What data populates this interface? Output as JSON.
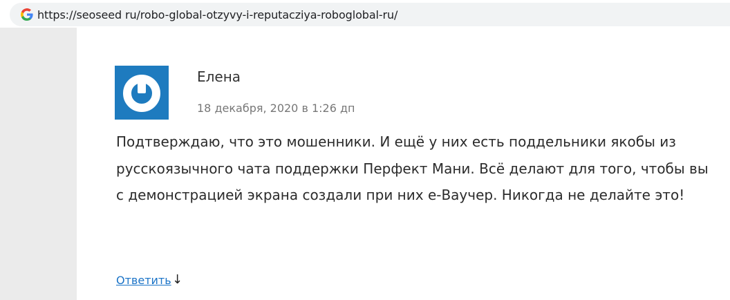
{
  "browser": {
    "url": "https://seoseed ru/robo-global-otzyvy-i-reputacziya-roboglobal-ru/",
    "site_icon": "google-g-icon"
  },
  "comment": {
    "author": "Елена",
    "date": "18 декабря, 2020 в 1:26 дп",
    "avatar_icon": "power-symbol-avatar-icon",
    "text": "Подтверждаю, что это мошенники. И ещё у них есть поддельники якобы из русскоязычного чата поддержки Перфект Мани. Всё делают для того, чтобы вы с демонстрацией экрана создали при них е-Ваучер. Никогда не делайте это!",
    "reply_label": "Ответить",
    "reply_arrow": "↓"
  },
  "colors": {
    "avatar_bg": "#1e7bbf",
    "link": "#1a73c7",
    "gutter": "#ebebeb"
  }
}
